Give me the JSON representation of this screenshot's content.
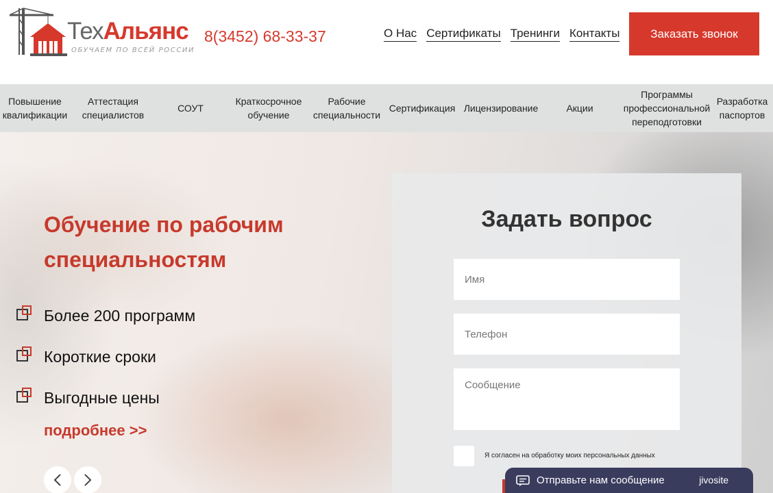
{
  "logo": {
    "part1": "Тех",
    "part2": "Альянс",
    "tagline": "ОБУЧАЕМ ПО ВСЕЙ РОССИИ"
  },
  "phone": "8(3452) 68-33-37",
  "top_nav": [
    {
      "label": "О Нас"
    },
    {
      "label": "Сертификаты"
    },
    {
      "label": "Тренинги"
    },
    {
      "label": "Контакты"
    }
  ],
  "call_button": "Заказать звонок",
  "menu": [
    {
      "label": "Повышение квалификации"
    },
    {
      "label": "Аттестация специалистов"
    },
    {
      "label": "СОУТ"
    },
    {
      "label": "Краткосрочное обучение"
    },
    {
      "label": "Рабочие специальности"
    },
    {
      "label": "Сертификация"
    },
    {
      "label": "Лицензирование"
    },
    {
      "label": "Акции"
    },
    {
      "label": "Программы профессиональной переподготовки"
    },
    {
      "label": "Разработка паспортов"
    }
  ],
  "hero": {
    "title": "Обучение по рабочим специальностям",
    "features": [
      {
        "label": "Более 200 программ"
      },
      {
        "label": "Короткие сроки"
      },
      {
        "label": "Выгодные цены"
      }
    ],
    "more_link": "подробнее >>"
  },
  "form": {
    "title": "Задать вопрос",
    "name_placeholder": "Имя",
    "phone_placeholder": "Телефон",
    "message_placeholder": "Сообщение",
    "consent_label": "Я согласен на обработку моих персональных данных"
  },
  "chat_widget": {
    "text": "Отправьте нам сообщение",
    "brand": "jivosite"
  },
  "colors": {
    "accent": "#d6392c",
    "menu_bg": "#dfe1e1",
    "chat_bg": "#3a3c5e"
  }
}
